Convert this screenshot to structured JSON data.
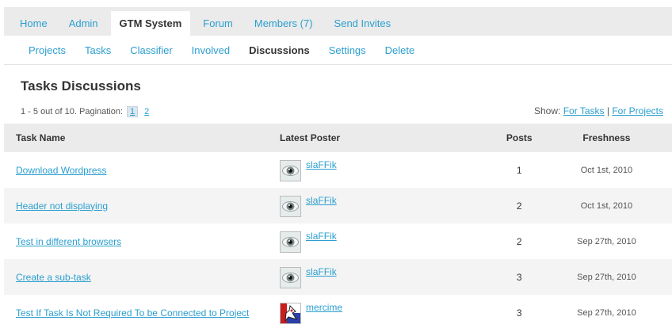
{
  "nav_primary": [
    "Home",
    "Admin",
    "GTM System",
    "Forum",
    "Members (7)",
    "Send Invites"
  ],
  "nav_primary_active": "GTM System",
  "nav_secondary": [
    "Projects",
    "Tasks",
    "Classifier",
    "Involved",
    "Discussions",
    "Settings",
    "Delete"
  ],
  "nav_secondary_active": "Discussions",
  "page_title": "Tasks Discussions",
  "pagination": {
    "summary": "1 - 5 out of 10. Pagination:",
    "pages": [
      "1",
      "2"
    ],
    "current": "1"
  },
  "show": {
    "label": "Show:",
    "for_tasks": "For Tasks",
    "separator": "|",
    "for_projects": "For Projects"
  },
  "table": {
    "headers": {
      "task": "Task Name",
      "poster": "Latest Poster",
      "posts": "Posts",
      "freshness": "Freshness"
    },
    "rows": [
      {
        "task": "Download Wordpress",
        "poster": "slaFFik",
        "avatar": "eye-avatar",
        "posts": "1",
        "freshness": "Oct 1st, 2010"
      },
      {
        "task": "Header not displaying",
        "poster": "slaFFik",
        "avatar": "eye-avatar",
        "posts": "2",
        "freshness": "Oct 1st, 2010"
      },
      {
        "task": "Test in different browsers",
        "poster": "slaFFik",
        "avatar": "eye-avatar",
        "posts": "2",
        "freshness": "Sep 27th, 2010"
      },
      {
        "task": "Create a sub-task",
        "poster": "slaFFik",
        "avatar": "eye-avatar",
        "posts": "3",
        "freshness": "Sep 27th, 2010"
      },
      {
        "task": "Test If Task Is Not Required To be Connected to Project",
        "poster": "mercime",
        "avatar": "red-blue-avatar",
        "posts": "3",
        "freshness": "Sep 27th, 2010"
      }
    ]
  },
  "colors": {
    "link": "#2b9fcf",
    "nav_bg": "#ebebeb",
    "row_alt": "#f4f4f4"
  }
}
